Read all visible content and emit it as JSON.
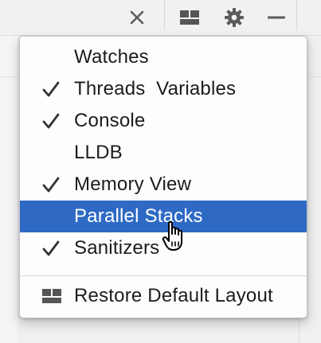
{
  "toolbar": {
    "icons": [
      "close-icon",
      "layout-icon",
      "gear-icon",
      "minimize-icon"
    ]
  },
  "menu": {
    "items": [
      {
        "label": "Watches",
        "checked": false
      },
      {
        "label": "Threads  Variables",
        "checked": true
      },
      {
        "label": "Console",
        "checked": true
      },
      {
        "label": "LLDB",
        "checked": false
      },
      {
        "label": "Memory View",
        "checked": true
      },
      {
        "label": "Parallel Stacks",
        "checked": false,
        "highlighted": true
      },
      {
        "label": "Sanitizers",
        "checked": true
      }
    ],
    "restore": {
      "label": "Restore Default Layout",
      "icon": "layout-icon"
    }
  },
  "colors": {
    "highlight": "#2e6ac4",
    "text": "#1c1c1c",
    "icon": "#5a5a5a"
  }
}
